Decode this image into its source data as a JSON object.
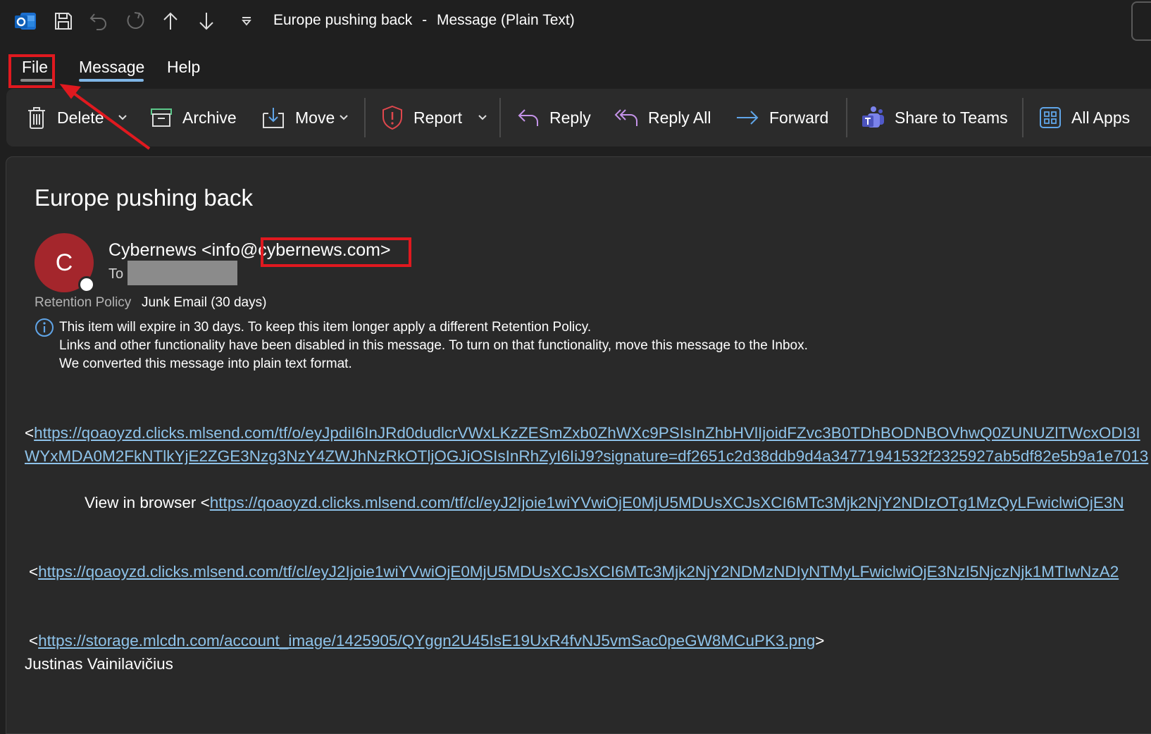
{
  "window": {
    "title": "Europe pushing back",
    "title_sep": "-",
    "title_suffix": "Message (Plain Text)"
  },
  "menu": {
    "file": "File",
    "message": "Message",
    "help": "Help"
  },
  "ribbon": {
    "delete": "Delete",
    "archive": "Archive",
    "move": "Move",
    "report": "Report",
    "reply": "Reply",
    "reply_all": "Reply All",
    "forward": "Forward",
    "share_to_teams": "Share to Teams",
    "all_apps": "All Apps"
  },
  "message": {
    "subject": "Europe pushing back",
    "avatar_initial": "C",
    "sender_name": "Cybernews <info@",
    "sender_domain": "cybernews.com>",
    "to_label": "To",
    "retention_label": "Retention Policy",
    "retention_value": "Junk Email (30 days)",
    "info_lines": [
      "This item will expire in 30 days. To keep this item longer apply a different Retention Policy.",
      "Links and other functionality have been disabled in this message. To turn on that functionality, move this message to the Inbox.",
      "We converted this message into plain text format."
    ]
  },
  "body": {
    "lt": "<",
    "gt": ">",
    "link1_line1": "https://qoaoyzd.clicks.mlsend.com/tf/o/eyJpdiI6InJRd0dudlcrVWxLKzZESmZxb0ZhWXc9PSIsInZhbHVlIjoidFZvc3B0TDhBODNBOVhwQ0ZUNUZlTWcxODI3I",
    "link1_line2": "WYxMDA0M2FkNTlkYjE2ZGE3Nzg3NzY4ZWJhNzRkOTljOGJiOSIsInRhZyI6IiJ9?signature=df2651c2d38ddb9d4a34771941532f2325927ab5df82e5b9a1e7013",
    "view_in_browser": "View in browser <",
    "link2": "https://qoaoyzd.clicks.mlsend.com/tf/cl/eyJ2Ijoie1wiYVwiOjE0MjU5MDUsXCJsXCI6MTc3Mjk2NjY2NDIzOTg1MzQyLFwiclwiOjE3N",
    "link3": "https://qoaoyzd.clicks.mlsend.com/tf/cl/eyJ2Ijoie1wiYVwiOjE0MjU5MDUsXCJsXCI6MTc3Mjk2NjY2NDMzNDIyNTMyLFwiclwiOjE3NzI5NjczNjk1MTIwNzA2",
    "link4": "https://storage.mlcdn.com/account_image/1425905/QYggn2U45IsE19UxR4fvNJ5vmSac0peGW8MCuPK3.png",
    "signature": "Justinas Vainilavičius"
  },
  "colors": {
    "accent_red": "#e0191f",
    "link": "#8ec3ea",
    "avatar": "#a4262c",
    "teams": "#7b83eb",
    "icon_blue": "#60a5e8"
  },
  "icons": [
    "outlook-icon",
    "save-icon",
    "undo-icon",
    "redo-icon",
    "arrow-up-icon",
    "arrow-down-icon",
    "customize-icon",
    "trash-icon",
    "archive-icon",
    "move-icon",
    "shield-icon",
    "reply-icon",
    "reply-all-icon",
    "forward-icon",
    "teams-icon",
    "apps-icon",
    "info-icon"
  ]
}
